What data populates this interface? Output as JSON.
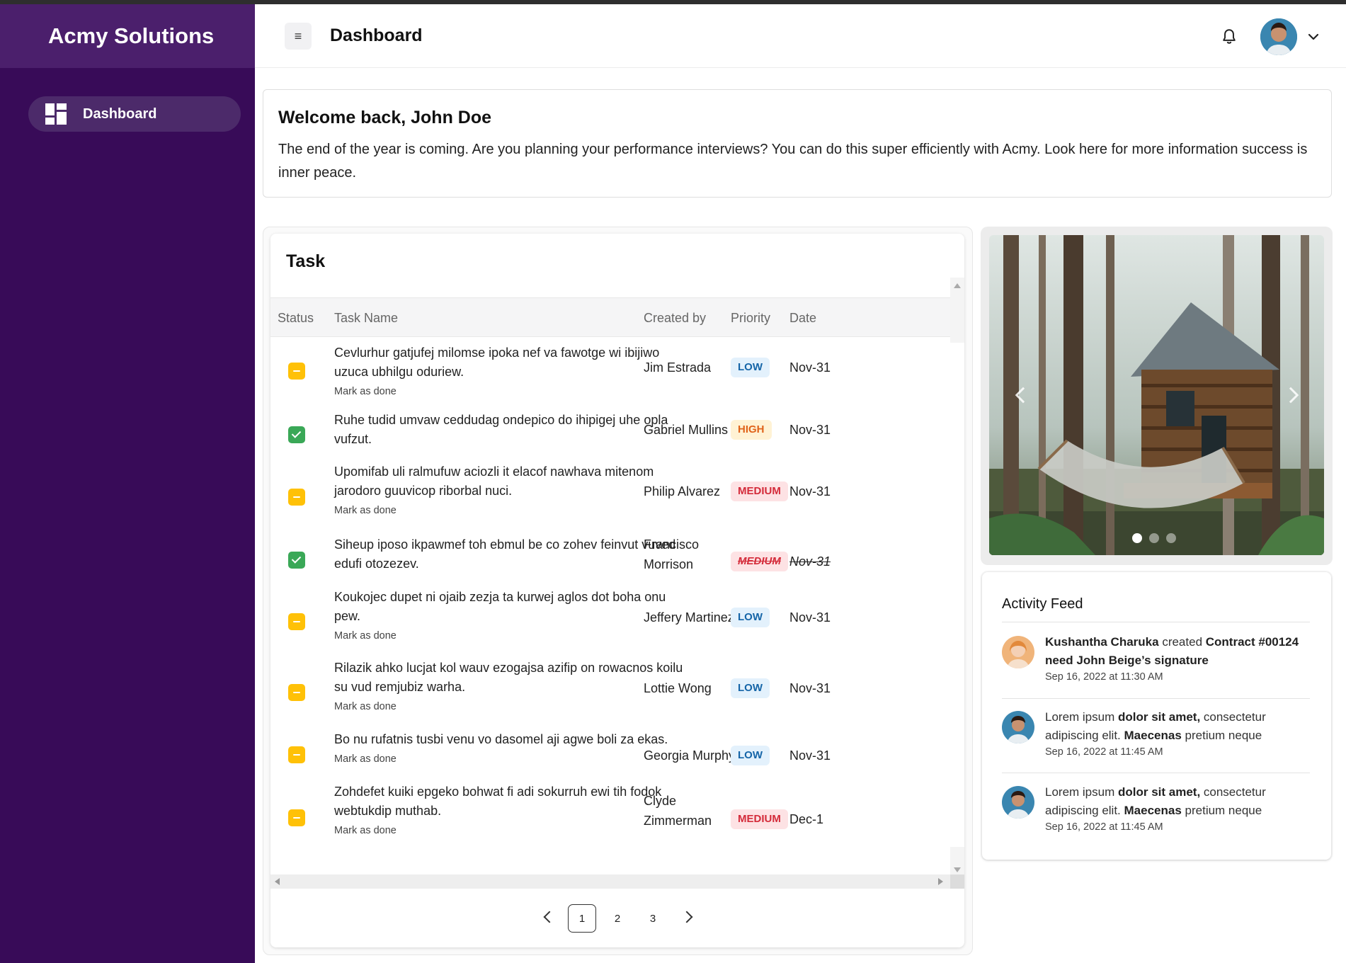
{
  "sidebar": {
    "brand": "Acmy Solutions",
    "items": [
      {
        "label": "Dashboard",
        "icon": "dashboard-icon"
      }
    ]
  },
  "header": {
    "title": "Dashboard",
    "menu_icon": "≡",
    "notification_icon": "bell-icon",
    "profile_icon": "user-avatar"
  },
  "welcome": {
    "title": "Welcome back, John Doe",
    "text": "The end of the year is coming. Are you planning your performance interviews? You can do this super efficiently with Acmy. Look here for more information success is inner peace."
  },
  "tasks": {
    "title": "Task",
    "columns": {
      "status": "Status",
      "name": "Task Name",
      "created_by": "Created by",
      "priority": "Priority",
      "date": "Date"
    },
    "mark_done_label": "Mark as done",
    "rows": [
      {
        "status": "pending",
        "name": "Cevlurhur gatjufej milomse ipoka nef va fawotge wi ibijiwo uzuca ubhilgu oduriew.",
        "created_by": "Jim Estrada",
        "priority": "LOW",
        "date": "Nov-31"
      },
      {
        "status": "done",
        "name": "Ruhe tudid umvaw ceddudag ondepico do ihipigej uhe opla vufzut.",
        "created_by": "Gabriel Mullins",
        "priority": "HIGH",
        "date": "Nov-31"
      },
      {
        "status": "pending",
        "name": "Upomifab uli ralmufuw aciozli it elacof nawhava mitenom jarodoro guuvicop riborbal nuci.",
        "created_by": "Philip Alvarez",
        "priority": "MEDIUM",
        "date": "Nov-31"
      },
      {
        "status": "done",
        "name": "Siheup iposo ikpawmef toh ebmul be co zohev feinvut vuved edufi otozezev.",
        "created_by": "Francisco Morrison",
        "priority": "MEDIUM",
        "date": "Nov-31"
      },
      {
        "status": "pending",
        "name": "Koukojec dupet ni ojaib zezja ta kurwej aglos dot boha onu pew.",
        "created_by": "Jeffery Martinez",
        "priority": "LOW",
        "date": "Nov-31"
      },
      {
        "status": "pending",
        "name": "Rilazik ahko lucjat kol wauv ezogajsa azifip on rowacnos koilu su vud remjubiz warha.",
        "created_by": "Lottie Wong",
        "priority": "LOW",
        "date": "Nov-31"
      },
      {
        "status": "pending",
        "name": "Bo nu rufatnis tusbi venu vo dasomel aji agwe boli za ekas.",
        "created_by": "Georgia Murphy",
        "priority": "LOW",
        "date": "Nov-31"
      },
      {
        "status": "pending",
        "name": "Zohdefet kuiki epgeko bohwat fi adi sokurruh ewi tih fodok webtukdip muthab.",
        "created_by": "Clyde Zimmerman",
        "priority": "MEDIUM",
        "date": "Dec-1"
      }
    ],
    "pagination": {
      "pages": [
        "1",
        "2",
        "3"
      ],
      "current": "1"
    }
  },
  "carousel": {
    "slides": 3,
    "active": 0
  },
  "activity": {
    "title": "Activity Feed",
    "items": [
      {
        "actor": "Kushantha Charuka",
        "verb": " created ",
        "object": "Contract #00124 need John Beige’s signature",
        "time": "Sep 16, 2022 at 11:30 AM"
      },
      {
        "pre": "Lorem ipsum ",
        "bold1": "dolor sit amet,",
        "mid": " consectetur adipiscing elit. ",
        "bold2": "Maecenas",
        "post": " pretium neque",
        "time": "Sep 16, 2022 at 11:45 AM"
      },
      {
        "pre": "Lorem ipsum ",
        "bold1": "dolor sit amet,",
        "mid": " consectetur adipiscing elit. ",
        "bold2": "Maecenas",
        "post": " pretium neque",
        "time": "Sep 16, 2022 at 11:45 AM"
      }
    ]
  },
  "colors": {
    "sidebar": "#380b58",
    "brand_bar": "#4b1f6c",
    "pending": "#ffc107",
    "done": "#3aa857",
    "low": "#1565a8",
    "high": "#e0631a",
    "medium": "#d42b3a"
  }
}
